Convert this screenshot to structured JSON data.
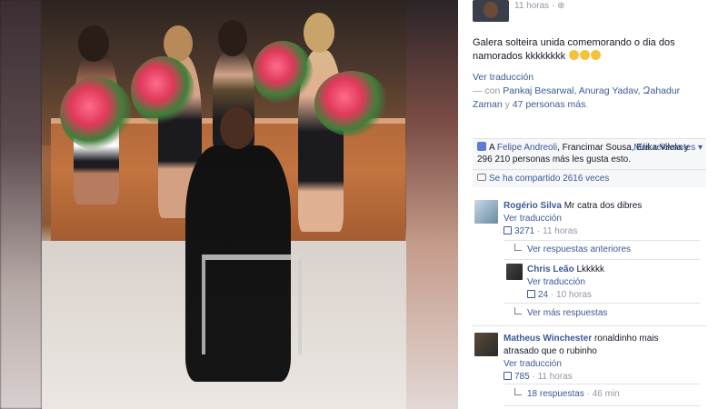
{
  "post": {
    "time": "11 horas",
    "text_main": "Galera solteira unida comemorando o dia dos namorados kkkkkkkk",
    "translate": "Ver traducción",
    "tagged_prefix": "— con",
    "tagged_names": "Pankaj Besarwal, Anurag Yadav, Զahadur Zaman",
    "tagged_suffix": "y",
    "tagged_more": "47 personas más",
    "tagged_end": "."
  },
  "likes": {
    "prefix": "A",
    "names_link": "Felipe Andreoli",
    "names_rest": ", Francimar Sousa, Erika Vilela y 296 210 personas más les gusta esto.",
    "relevant": "Más relevantes ▾",
    "shares": "Se ha compartido 2616 veces"
  },
  "comments": [
    {
      "name": "Rogério Silva",
      "text": "Mr catra dos dibres",
      "translate": "Ver traducción",
      "likes": "3271",
      "time": "11 horas",
      "replies_link": "Ver respuestas anteriores"
    },
    {
      "name": "Chris Leão",
      "text": "Lkkkkk",
      "translate": "Ver traducción",
      "likes": "24",
      "time": "10 horas",
      "replies_link": "Ver más respuestas"
    },
    {
      "name": "Matheus Winchester",
      "text": "ronaldinho mais atrasado que o rubinho",
      "translate": "Ver traducción",
      "likes": "785",
      "time": "11 horas",
      "replies_link": "18 respuestas",
      "replies_time": "46 min"
    }
  ],
  "colors": {
    "link": "#3b5998",
    "meta": "#9197a3",
    "panel_bg": "#ffffff"
  }
}
